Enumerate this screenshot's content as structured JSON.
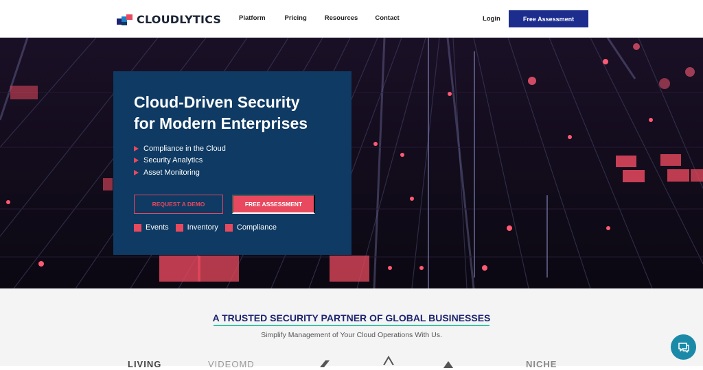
{
  "header": {
    "logo_text": "CLOUDLYTICS",
    "nav": [
      "Platform",
      "Pricing",
      "Resources",
      "Contact"
    ],
    "login_label": "Login",
    "cta_label": "Free Assessment"
  },
  "hero": {
    "title_line1": "Cloud-Driven Security",
    "title_line2": "for Modern Enterprises",
    "features": [
      "Compliance in the Cloud",
      "Security Analytics",
      "Asset Monitoring"
    ],
    "demo_button": "REQUEST A DEMO",
    "assessment_button": "FREE ASSESSMENT",
    "tags": [
      "Events",
      "Inventory",
      "Compliance"
    ]
  },
  "trust": {
    "title": "A TRUSTED SECURITY PARTNER OF GLOBAL BUSINESSES",
    "subtitle": "Simplify Management of Your Cloud Operations With Us.",
    "partners": [
      "LIVING",
      "VIDEOMD",
      "",
      "",
      "",
      "NICHE"
    ]
  },
  "colors": {
    "brand_navy": "#1d2d8e",
    "card_blue": "#0e3a63",
    "accent_coral": "#e8495e",
    "underline_teal": "#3bc1a8",
    "chat_teal": "#1b8aa8"
  },
  "icons": {
    "chat": "chat-bubble-icon",
    "bullet": "triangle-bullet-icon",
    "logo": "cloudlytics-logo-icon"
  }
}
